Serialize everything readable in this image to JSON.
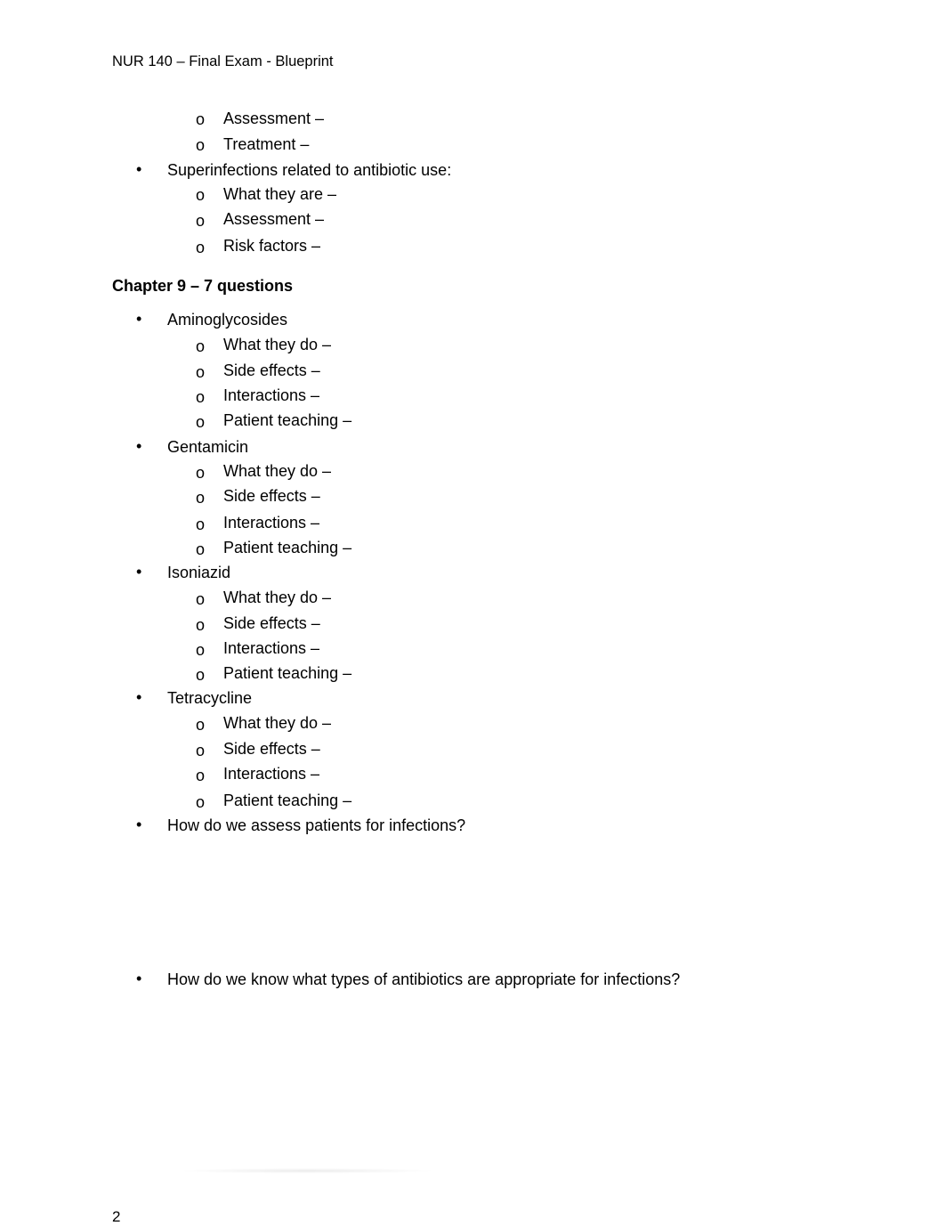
{
  "header": {
    "title": "NUR 140 – Final Exam - Blueprint"
  },
  "top_items": [
    {
      "level": 2,
      "text": "Assessment –"
    },
    {
      "level": 2,
      "text": "Treatment –"
    },
    {
      "level": 1,
      "text": "Superinfections related to antibiotic use:"
    },
    {
      "level": 2,
      "text": "What they are –"
    },
    {
      "level": 2,
      "text": "Assessment –"
    },
    {
      "level": 2,
      "text": "Risk factors –"
    }
  ],
  "chapter": {
    "heading": "Chapter 9 – 7 questions",
    "drugs": [
      {
        "name": "Aminoglycosides",
        "subitems": [
          "What they do –",
          "Side effects –",
          "Interactions –",
          "Patient teaching –"
        ]
      },
      {
        "name": "Gentamicin",
        "subitems": [
          "What they do –",
          "Side effects –",
          "Interactions –",
          "Patient teaching –"
        ]
      },
      {
        "name": "Isoniazid",
        "subitems": [
          "What they do –",
          "Side effects –",
          "Interactions –",
          "Patient teaching –"
        ]
      },
      {
        "name": "Tetracycline",
        "subitems": [
          "What they do –",
          "Side effects –",
          "Interactions –",
          "Patient teaching –"
        ]
      }
    ],
    "questions": [
      "How do we assess patients for infections?",
      "How do we know what types of antibiotics are appropriate for infections?"
    ]
  },
  "bullets": {
    "level1": "•",
    "level2": "o"
  },
  "footer": {
    "page_number": "2"
  }
}
